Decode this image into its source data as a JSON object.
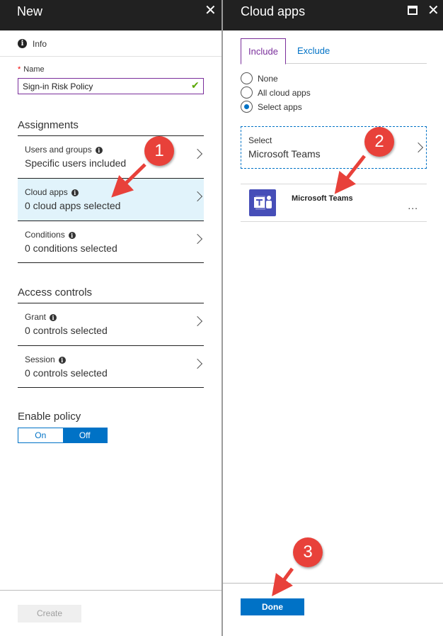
{
  "left_blade": {
    "title": "New",
    "close_glyph": "✕",
    "info_label": "Info",
    "name_label": "Name",
    "name_required_mark": "*",
    "name_value": "Sign-in Risk Policy",
    "assignments_heading": "Assignments",
    "assignments": [
      {
        "label": "Users and groups",
        "value": "Specific users included"
      },
      {
        "label": "Cloud apps",
        "value": "0 cloud apps selected"
      },
      {
        "label": "Conditions",
        "value": "0 conditions selected"
      }
    ],
    "access_controls_heading": "Access controls",
    "access_controls": [
      {
        "label": "Grant",
        "value": "0 controls selected"
      },
      {
        "label": "Session",
        "value": "0 controls selected"
      }
    ],
    "enable_policy_heading": "Enable policy",
    "toggle": {
      "on_label": "On",
      "off_label": "Off",
      "selected": "Off"
    },
    "create_label": "Create"
  },
  "right_blade": {
    "title": "Cloud apps",
    "close_glyph": "✕",
    "tabs": [
      {
        "label": "Include",
        "active": true
      },
      {
        "label": "Exclude",
        "active": false
      }
    ],
    "radio_options": [
      {
        "label": "None",
        "checked": false
      },
      {
        "label": "All cloud apps",
        "checked": false
      },
      {
        "label": "Select apps",
        "checked": true
      }
    ],
    "select_label": "Select",
    "select_value": "Microsoft Teams",
    "app_name": "Microsoft Teams",
    "more_glyph": "...",
    "done_label": "Done"
  },
  "annotations": {
    "badge_1": "1",
    "badge_2": "2",
    "badge_3": "3"
  },
  "colors": {
    "title_bar": "#212121",
    "accent_blue": "#0072c6",
    "accent_purple": "#7a2e9b",
    "active_row": "#e1f3fb",
    "badge_red": "#e8413a",
    "teams_purple": "#464eb8"
  }
}
